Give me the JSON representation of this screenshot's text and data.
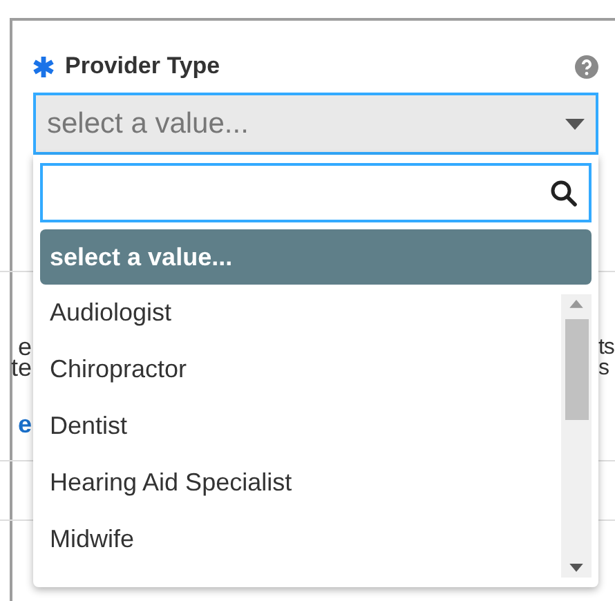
{
  "field": {
    "label": "Provider Type",
    "required": true,
    "placeholder": "select a value...",
    "expanded": true
  },
  "options": [
    {
      "label": "select a value...",
      "selected": true
    },
    {
      "label": "Audiologist",
      "selected": false
    },
    {
      "label": "Chiropractor",
      "selected": false
    },
    {
      "label": "Dentist",
      "selected": false
    },
    {
      "label": "Hearing Aid Specialist",
      "selected": false
    },
    {
      "label": "Midwife",
      "selected": false
    }
  ],
  "background": {
    "left_texts": [
      {
        "text": "e",
        "kind": "plain"
      },
      {
        "text": "te",
        "kind": "plain"
      },
      {
        "text": "e",
        "kind": "link"
      }
    ],
    "right_texts": [
      "ts",
      "s"
    ]
  }
}
